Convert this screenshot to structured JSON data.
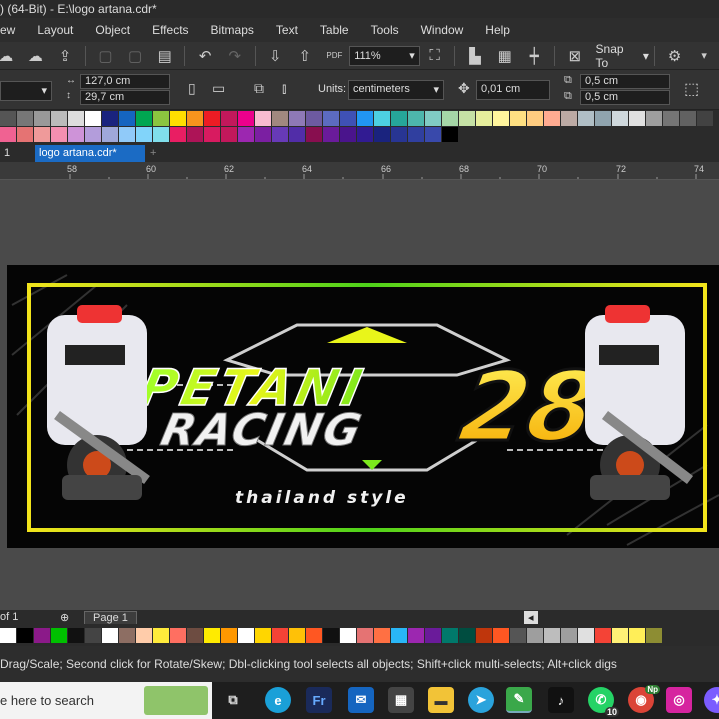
{
  "window": {
    "title": ") (64-Bit) - E:\\logo artana.cdr*"
  },
  "menu": [
    "ew",
    "Layout",
    "Object",
    "Effects",
    "Bitmaps",
    "Text",
    "Table",
    "Tools",
    "Window",
    "Help"
  ],
  "toolbar": {
    "zoom": "111%",
    "snap_label": "Snap To"
  },
  "properties": {
    "width": "127,0 cm",
    "height": "29,7 cm",
    "units_label": "Units:",
    "units_value": "centimeters",
    "nudge": "0,01 cm",
    "dup_x": "0,5 cm",
    "dup_y": "0,5 cm"
  },
  "document_tabs": {
    "home_fragment": "1",
    "active": "logo artana.cdr*",
    "add": "+"
  },
  "ruler": {
    "ticks": [
      "58",
      "60",
      "62",
      "64",
      "66",
      "68",
      "70",
      "72",
      "74"
    ]
  },
  "artwork": {
    "line1": "PETANI",
    "line2": "RACING",
    "number": "28",
    "tagline": "thailand style",
    "colors": {
      "green": "#7be81c",
      "yellow": "#f2e41b",
      "frame": "#d8e71a"
    }
  },
  "page_nav": {
    "count": "of 1",
    "page_tab": "Page 1"
  },
  "status": {
    "message": "Drag/Scale; Second click for Rotate/Skew; Dbl-clicking tool selects all objects; Shift+click multi-selects; Alt+click digs"
  },
  "taskbar": {
    "search_placeholder": "e here to search",
    "whatsapp_badge": "10",
    "chrome_badge": "Np"
  },
  "palette_colors_top": [
    "#555",
    "#777",
    "#999",
    "#bbb",
    "#ddd",
    "#fff",
    "#1a237e",
    "#1565c0",
    "#00a651",
    "#8bc53f",
    "#ffde00",
    "#f7941d",
    "#ed1c24",
    "#c2185b",
    "#ec008c",
    "#f8bbd0",
    "#a1887f",
    "#8e79b6",
    "#6d5aa0",
    "#5c6bc0",
    "#3f51b5",
    "#2196f3",
    "#4dd0e1",
    "#26a69a",
    "#4db6ac",
    "#80cbc4",
    "#a5d6a7",
    "#c5e1a5",
    "#e6ee9c",
    "#fff59d",
    "#ffe082",
    "#ffcc80",
    "#ffab91",
    "#bcaaa4",
    "#b0bec5",
    "#90a4ae",
    "#cfd8dc",
    "#e0e0e0",
    "#9e9e9e",
    "#757575",
    "#616161",
    "#424242"
  ],
  "palette_colors_bottom": [
    "#f06292",
    "#e57373",
    "#ef9a9a",
    "#f48fb1",
    "#ce93d8",
    "#b39ddb",
    "#9fa8da",
    "#90caf9",
    "#81d4fa",
    "#80deea",
    "#e91e63",
    "#ad1457",
    "#d81b60",
    "#c2185b",
    "#9c27b0",
    "#7b1fa2",
    "#673ab7",
    "#512da8",
    "#880e4f",
    "#6a1b9a",
    "#4a148c",
    "#311b92",
    "#1a237e",
    "#283593",
    "#303f9f",
    "#3949ab",
    "#000000"
  ],
  "palette2_colors": [
    "#fff",
    "#000",
    "#8b1a89",
    "#00c000",
    "#111",
    "#444",
    "#fff",
    "#8d6e63",
    "#ffccaa",
    "#ffeb3b",
    "#ff6f61",
    "#6d4c41",
    "#ffeb00",
    "#ff9800",
    "#ffffff",
    "#ffd600",
    "#f44336",
    "#ffc107",
    "#ff5722",
    "#111",
    "#ffffff",
    "#e57373",
    "#ff7043",
    "#29b6f6",
    "#9c27b0",
    "#6a1b9a",
    "#00796b",
    "#004d40",
    "#bf360c",
    "#ff5722",
    "#555",
    "#9e9e9e",
    "#bdbdbd",
    "#9e9e9e",
    "#e0e0e0",
    "#f44336",
    "#fff176",
    "#ffee58",
    "#8d8d33"
  ]
}
